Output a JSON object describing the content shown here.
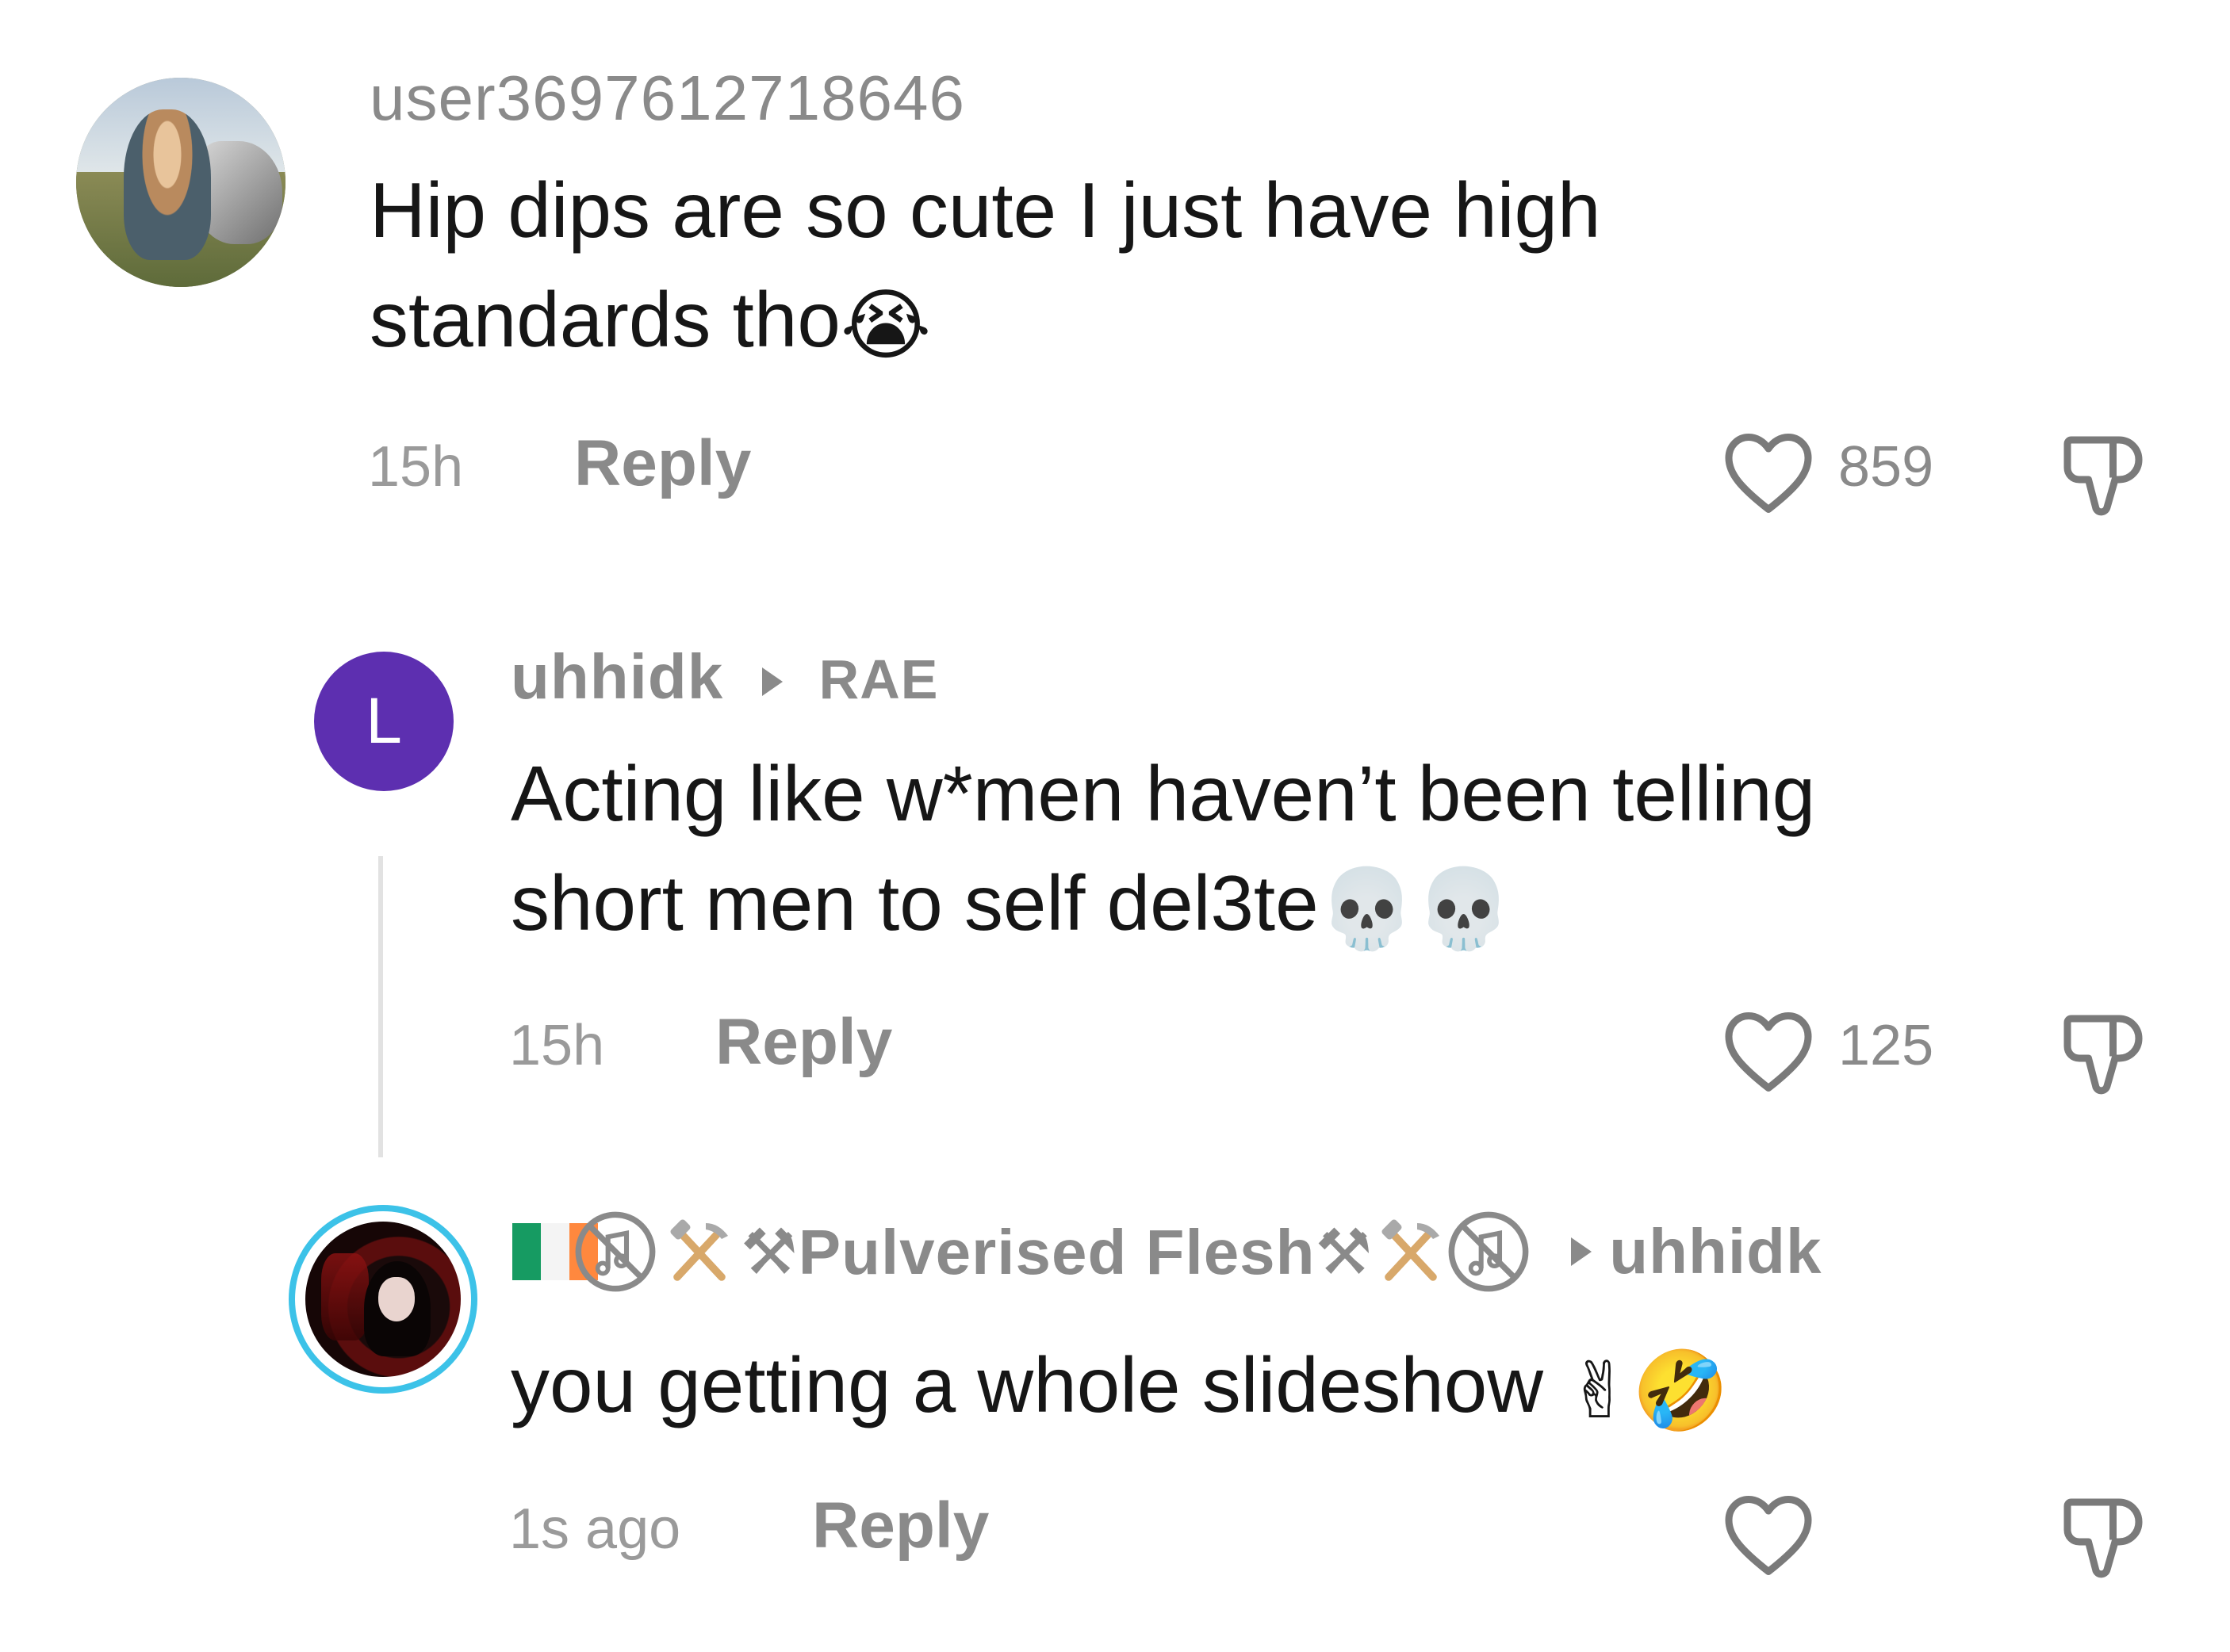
{
  "comments": [
    {
      "username": "user3697612718646",
      "text_line1": "Hip dips are so cute I just have high",
      "text_line2": "standards tho",
      "emoji": "😭",
      "time": "15h",
      "reply": "Reply",
      "likes": "859"
    },
    {
      "avatar_letter": "L",
      "username": "uhhidk",
      "reply_to": "RAE",
      "text_line1": "Acting like w*men haven’t been telling",
      "text_line2": "short men to self del3te",
      "emoji": "💀💀",
      "time": "15h",
      "reply": "Reply",
      "likes": "125"
    },
    {
      "username": "⚒Pulverised Flesh⚒",
      "reply_to": "uhhidk",
      "text": "you getting a whole slideshow",
      "emoji": "✌🤣",
      "time": "1s ago",
      "reply": "Reply",
      "likes": ""
    }
  ],
  "icons": {
    "like": "heart-outline-icon",
    "dislike": "thumbs-down-outline-icon",
    "flag": "ireland-flag-icon",
    "no_music": "no-music-icon",
    "hammer_pick": "hammer-and-pick-icon"
  },
  "colors": {
    "letter_avatar": "#5d2fb0",
    "story_ring": "#3cc2e8",
    "username": "#8a8a8a",
    "text": "#161616",
    "secondary": "#9a9a9a"
  }
}
